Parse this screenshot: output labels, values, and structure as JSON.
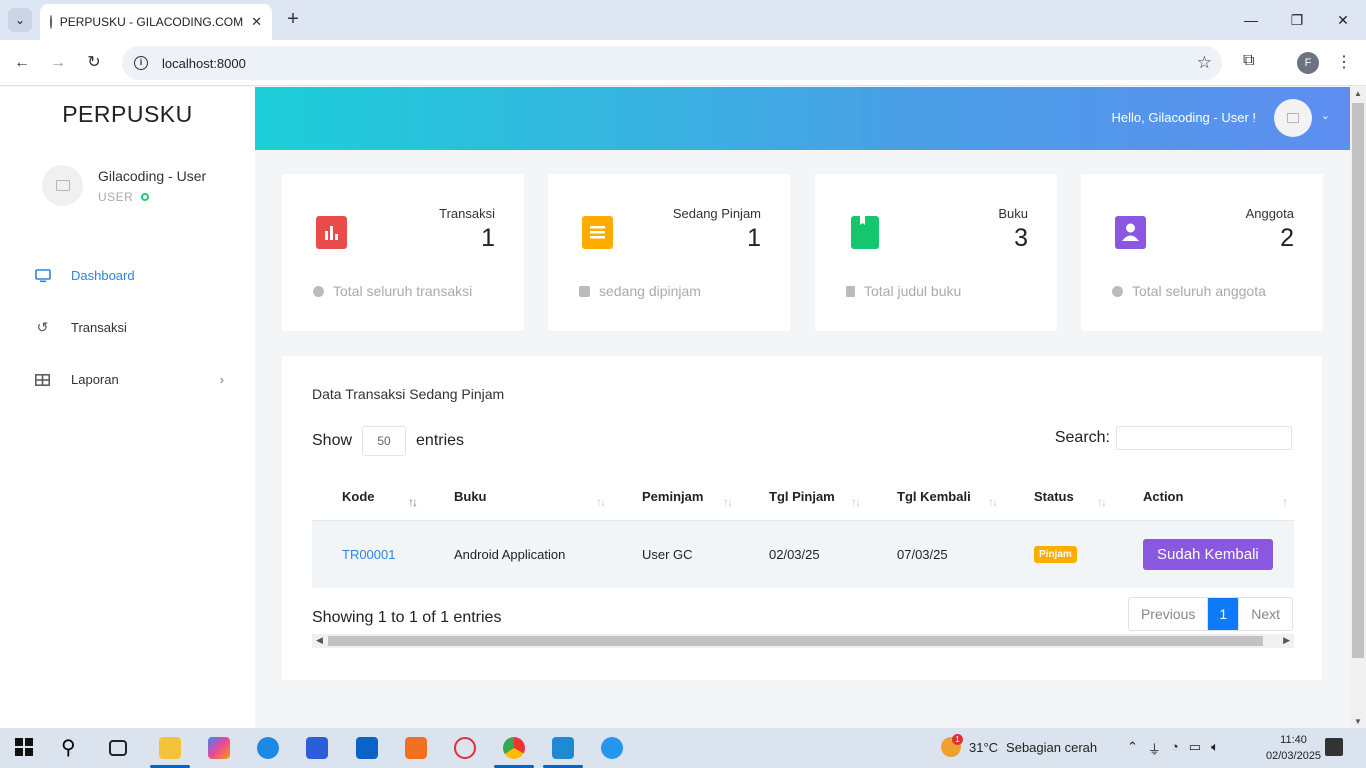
{
  "browser": {
    "tab_title": "PERPUSKU - GILACODING.COM",
    "url": "localhost:8000",
    "profile_initial": "F"
  },
  "sidebar": {
    "brand": "PERPUSKU",
    "user_name": "Gilacoding - User",
    "user_role": "USER",
    "items": [
      {
        "label": "Dashboard",
        "icon": "monitor-icon",
        "active": true
      },
      {
        "label": "Transaksi",
        "icon": "history-icon",
        "active": false
      },
      {
        "label": "Laporan",
        "icon": "table-icon",
        "active": false
      }
    ]
  },
  "topbar": {
    "greeting": "Hello, Gilacoding - User !"
  },
  "cards": [
    {
      "label": "Transaksi",
      "value": "1",
      "foot": "Total seluruh transaksi",
      "icon": "bar-chart-icon",
      "color": "#ea4c4c"
    },
    {
      "label": "Sedang Pinjam",
      "value": "1",
      "foot": "sedang dipinjam",
      "icon": "receipt-icon",
      "color": "#ffab00"
    },
    {
      "label": "Buku",
      "value": "3",
      "foot": "Total judul buku",
      "icon": "book-icon",
      "color": "#15c66e"
    },
    {
      "label": "Anggota",
      "value": "2",
      "foot": "Total seluruh anggota",
      "icon": "user-card-icon",
      "color": "#8a58e0"
    }
  ],
  "panel": {
    "title": "Data Transaksi Sedang Pinjam",
    "show_label": "Show",
    "entries_label": "entries",
    "page_length": "50",
    "search_label": "Search:",
    "columns": [
      "Kode",
      "Buku",
      "Peminjam",
      "Tgl Pinjam",
      "Tgl Kembali",
      "Status",
      "Action"
    ],
    "rows": [
      {
        "kode": "TR00001",
        "buku": "Android Application",
        "peminjam": "User GC",
        "tgl_pinjam": "02/03/25",
        "tgl_kembali": "07/03/25",
        "status": "Pinjam",
        "action": "Sudah Kembali"
      }
    ],
    "info": "Showing 1 to 1 of 1 entries",
    "pager": {
      "prev": "Previous",
      "current": "1",
      "next": "Next"
    }
  },
  "taskbar": {
    "weather_temp": "31°C",
    "weather_desc": "Sebagian cerah",
    "weather_badge": "1",
    "time": "11:40",
    "date": "02/03/2025"
  }
}
